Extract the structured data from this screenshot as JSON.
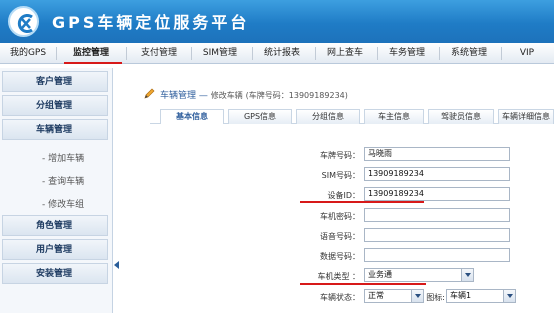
{
  "app": {
    "title": "GPS车辆定位服务平台",
    "logo_icon": "logo-icon"
  },
  "nav": {
    "items": [
      "我的GPS",
      "监控管理",
      "支付管理",
      "SIM管理",
      "统计报表",
      "网上查车",
      "车务管理",
      "系统管理",
      "VIP"
    ],
    "active": "监控管理"
  },
  "sidebar": {
    "items": [
      "客户管理",
      "分组管理",
      "车辆管理"
    ],
    "sub_items": [
      "- 增加车辆",
      "- 查询车辆",
      "- 修改车组"
    ],
    "items_after": [
      "角色管理",
      "用户管理",
      "安装管理"
    ]
  },
  "breadcrumb": {
    "section": "车辆管理",
    "separator": "—",
    "action": "修改车辆",
    "plate_text": "(车牌号码：13909189234)"
  },
  "tabs": [
    "基本信息",
    "GPS信息",
    "分组信息",
    "车主信息",
    "驾驶员信息",
    "车辆详细信息"
  ],
  "form": {
    "plate_label": "车牌号码：",
    "plate_value": "马晓雨",
    "sim_label": "SIM号码：",
    "sim_value": "13909189234",
    "device_label": "设备ID：",
    "device_value": "13909189234",
    "password_label": "车机密码：",
    "password_value": "",
    "voice_label": "语音号码：",
    "voice_value": "",
    "data_label": "数据号码：",
    "data_value": "",
    "type_label": "车机类型 ：",
    "type_value": "业务通",
    "status_label": "车辆状态：",
    "status_value": "正常",
    "icon_label": "图标:",
    "icon_value": "车辆1"
  },
  "colors": {
    "header": "#1f7cc6",
    "accent_red": "#d71919",
    "sidebar_text": "#203d63"
  }
}
